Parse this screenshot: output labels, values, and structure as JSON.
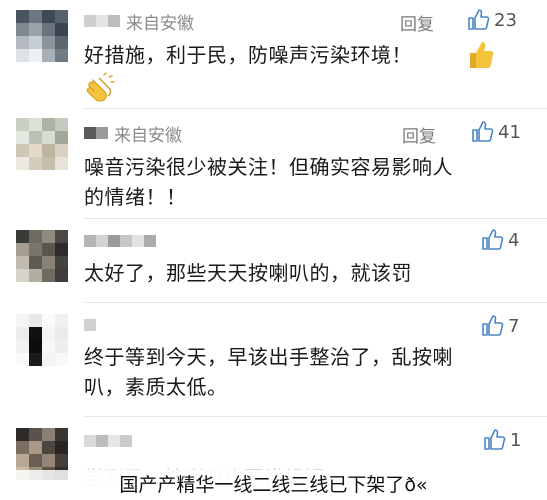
{
  "comments": [
    {
      "source": "来自安徽",
      "reply_label": "回复",
      "likes": "23",
      "text": "好措施，利于民，防噪声污染环境！"
    },
    {
      "source": "来自安徽",
      "reply_label": "回复",
      "likes": "41",
      "text_line1": "噪音污染很少被关注！但确实容易影响人",
      "text_line2": "的情绪！！"
    },
    {
      "likes": "4",
      "text": "太好了，那些天天按喇叭的，就该罚"
    },
    {
      "likes": "7",
      "text_line1": "终于等到今天，早该出手整治了，乱按喇",
      "text_line2": "叭，素质太低。"
    },
    {
      "likes": "1",
      "watermark_text": "学到了，按喇叭也要讲规矩"
    }
  ],
  "caption": "国产产精华一线二线三线已下架了ð«",
  "colors": {
    "accent_like": "#4a86c5",
    "thumb_emoji": "#f5c33b"
  }
}
